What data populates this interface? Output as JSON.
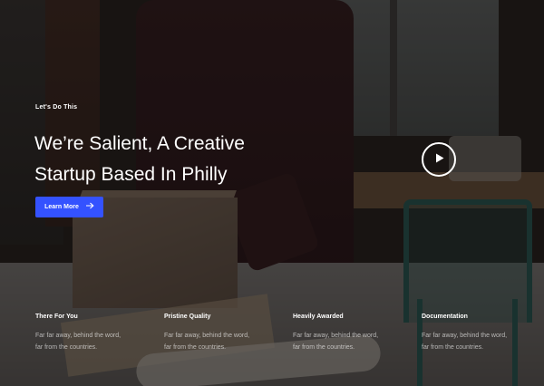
{
  "hero": {
    "eyebrow": "Let's Do This",
    "headline_line1": "We’re Salient, A Creative",
    "headline_line2": "Startup Based In Philly",
    "cta_label": "Learn More",
    "cta_icon": "arrow-right-icon",
    "play_icon": "play-icon"
  },
  "features": [
    {
      "title": "There For You",
      "text_line1": "Far far away, behind the word,",
      "text_line2": "far from the countries."
    },
    {
      "title": "Pristine Quality",
      "text_line1": "Far far away, behind the word,",
      "text_line2": "far from the countries."
    },
    {
      "title": "Heavily Awarded",
      "text_line1": "Far far away, behind the word,",
      "text_line2": "far from the countries."
    },
    {
      "title": "Documentation",
      "text_line1": "Far far away, behind the word,",
      "text_line2": "far from the countries."
    }
  ],
  "colors": {
    "accent": "#3452ff",
    "text": "#ffffff"
  }
}
